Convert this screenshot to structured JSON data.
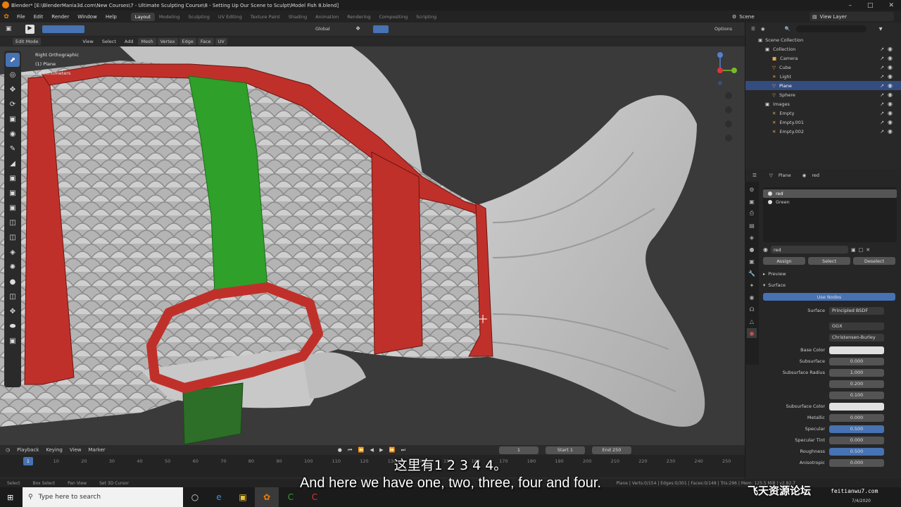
{
  "window": {
    "title": "Blender* [E:\\BlenderMania3d.com\\New Courses\\7 - Ultimate Sculpting Course\\8 - Setting Up Our Scene to Sculpt\\Model Fish 8.blend]"
  },
  "menu": [
    "File",
    "Edit",
    "Render",
    "Window",
    "Help"
  ],
  "workspaces": [
    "Layout",
    "Modeling",
    "Sculpting",
    "UV Editing",
    "Texture Paint",
    "Shading",
    "Animation",
    "Rendering",
    "Compositing",
    "Scripting"
  ],
  "active_workspace": "Layout",
  "scene_label": "Scene",
  "view_layer_label": "View Layer",
  "header": {
    "mode": "Edit Mode",
    "menus": [
      "View",
      "Select",
      "Add",
      "Mesh",
      "Vertex",
      "Edge",
      "Face",
      "UV"
    ],
    "transform": "Global",
    "options": "Options"
  },
  "viewport_info": {
    "view": "Right Orthographic",
    "object": "(1) Plane",
    "scale": "10 Centimeters"
  },
  "outliner": {
    "root": "Scene Collection",
    "items": [
      {
        "label": "Collection",
        "level": 1,
        "icon": "collection-icon",
        "selected": false
      },
      {
        "label": "Camera",
        "level": 2,
        "icon": "camera-icon",
        "selected": false
      },
      {
        "label": "Cube",
        "level": 2,
        "icon": "mesh-icon",
        "selected": false
      },
      {
        "label": "Light",
        "level": 2,
        "icon": "light-icon",
        "selected": false
      },
      {
        "label": "Plane",
        "level": 2,
        "icon": "mesh-icon",
        "selected": true
      },
      {
        "label": "Sphere",
        "level": 2,
        "icon": "mesh-icon",
        "selected": false
      },
      {
        "label": "Images",
        "level": 1,
        "icon": "collection-icon",
        "selected": false
      },
      {
        "label": "Empty",
        "level": 2,
        "icon": "empty-icon",
        "selected": false
      },
      {
        "label": "Empty.001",
        "level": 2,
        "icon": "empty-icon",
        "selected": false
      },
      {
        "label": "Empty.002",
        "level": 2,
        "icon": "empty-icon",
        "selected": false
      }
    ]
  },
  "properties": {
    "object_name": "Plane",
    "material_name": "red",
    "slots": [
      {
        "label": "red",
        "selected": true
      },
      {
        "label": "Green",
        "selected": false
      }
    ],
    "material_field": "red",
    "buttons": [
      "Assign",
      "Select",
      "Deselect"
    ],
    "panels": [
      "Preview",
      "Surface"
    ],
    "use_nodes": "Use Nodes",
    "surface_label": "Surface",
    "surface_value": "Principled BSDF",
    "distribution": "GGX",
    "subsurface_method": "Christensen-Burley",
    "rows": [
      {
        "label": "Base Color",
        "value": "",
        "style": "white"
      },
      {
        "label": "Subsurface",
        "value": "0.000",
        "style": ""
      },
      {
        "label": "Subsurface Radius",
        "value": "1.000",
        "style": ""
      },
      {
        "label": "",
        "value": "0.200",
        "style": ""
      },
      {
        "label": "",
        "value": "0.100",
        "style": ""
      },
      {
        "label": "Subsurface Color",
        "value": "",
        "style": "white"
      },
      {
        "label": "Metallic",
        "value": "0.000",
        "style": ""
      },
      {
        "label": "Specular",
        "value": "0.500",
        "style": "blue"
      },
      {
        "label": "Specular Tint",
        "value": "0.000",
        "style": ""
      },
      {
        "label": "Roughness",
        "value": "0.500",
        "style": "blue"
      },
      {
        "label": "Anisotropic",
        "value": "0.000",
        "style": ""
      }
    ]
  },
  "timeline": {
    "menus": [
      "Playback",
      "Keying",
      "View",
      "Marker"
    ],
    "current_frame": "1",
    "start_label": "Start",
    "start": "1",
    "end_label": "End",
    "end": "250",
    "ticks": [
      "1",
      "10",
      "20",
      "30",
      "40",
      "50",
      "60",
      "70",
      "80",
      "90",
      "100",
      "110",
      "120",
      "130",
      "140",
      "150",
      "160",
      "170",
      "180",
      "190",
      "200",
      "210",
      "220",
      "230",
      "240",
      "250"
    ]
  },
  "statusbar": {
    "left": [
      "Select",
      "Box Select",
      "Pan View",
      "Set 3D Cursor"
    ],
    "right": "Plane | Verts:0/154 | Edges:0/301 | Faces:0/148 | Tris:296 | Mem: 125.5 MiB | v2.82.7"
  },
  "subtitles": {
    "chinese": "这里有1 2 3 4 4。",
    "english": "And here we have one, two, three, four and four."
  },
  "watermark": {
    "text": "飞天资源论坛",
    "url": "feitianwu7.com"
  },
  "taskbar": {
    "search_placeholder": "Type here to search",
    "date": "7/4/2020"
  },
  "colors": {
    "accent": "#4772b3",
    "mesh_red": "#c0302a",
    "mesh_green": "#2fa02a",
    "selected_row": "#334d80"
  }
}
